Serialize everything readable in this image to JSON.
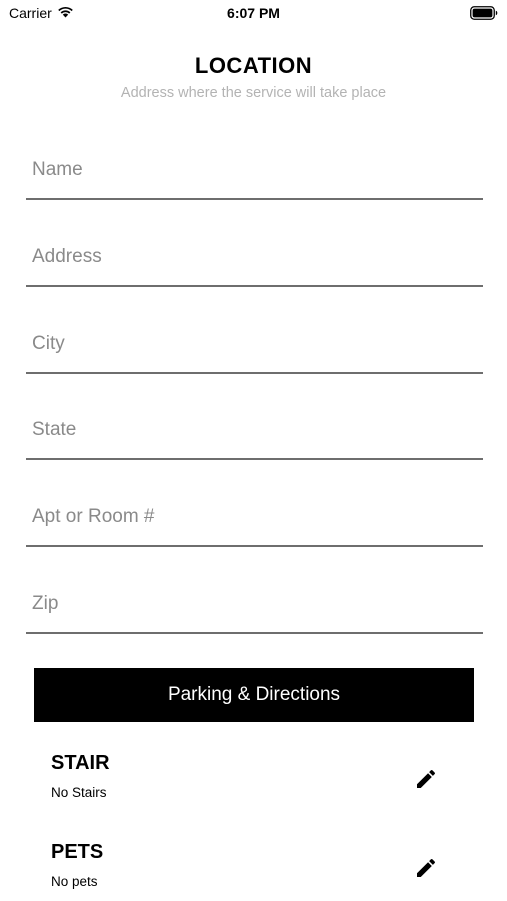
{
  "status_bar": {
    "carrier": "Carrier",
    "time": "6:07 PM",
    "icons": [
      "wifi-icon",
      "battery-icon"
    ]
  },
  "header": {
    "title": "LOCATION",
    "subtitle": "Address where the service will take place"
  },
  "form": {
    "name": {
      "value": "",
      "placeholder": "Name"
    },
    "address": {
      "value": "",
      "placeholder": "Address"
    },
    "city": {
      "value": "",
      "placeholder": "City"
    },
    "state": {
      "value": "",
      "placeholder": "State"
    },
    "apt": {
      "value": "",
      "placeholder": "Apt or Room #"
    },
    "zip": {
      "value": "",
      "placeholder": "Zip"
    }
  },
  "parking_button": {
    "label": "Parking & Directions"
  },
  "preferences": {
    "stair": {
      "title": "STAIR",
      "value": "No Stairs",
      "icon": "pencil-icon"
    },
    "pets": {
      "title": "PETS",
      "value": "No pets",
      "icon": "pencil-icon"
    }
  },
  "colors": {
    "accent": "#000000",
    "subtitle": "#b3b3b3",
    "placeholder": "#8a8a8a",
    "underline": "#6e6e6e"
  }
}
